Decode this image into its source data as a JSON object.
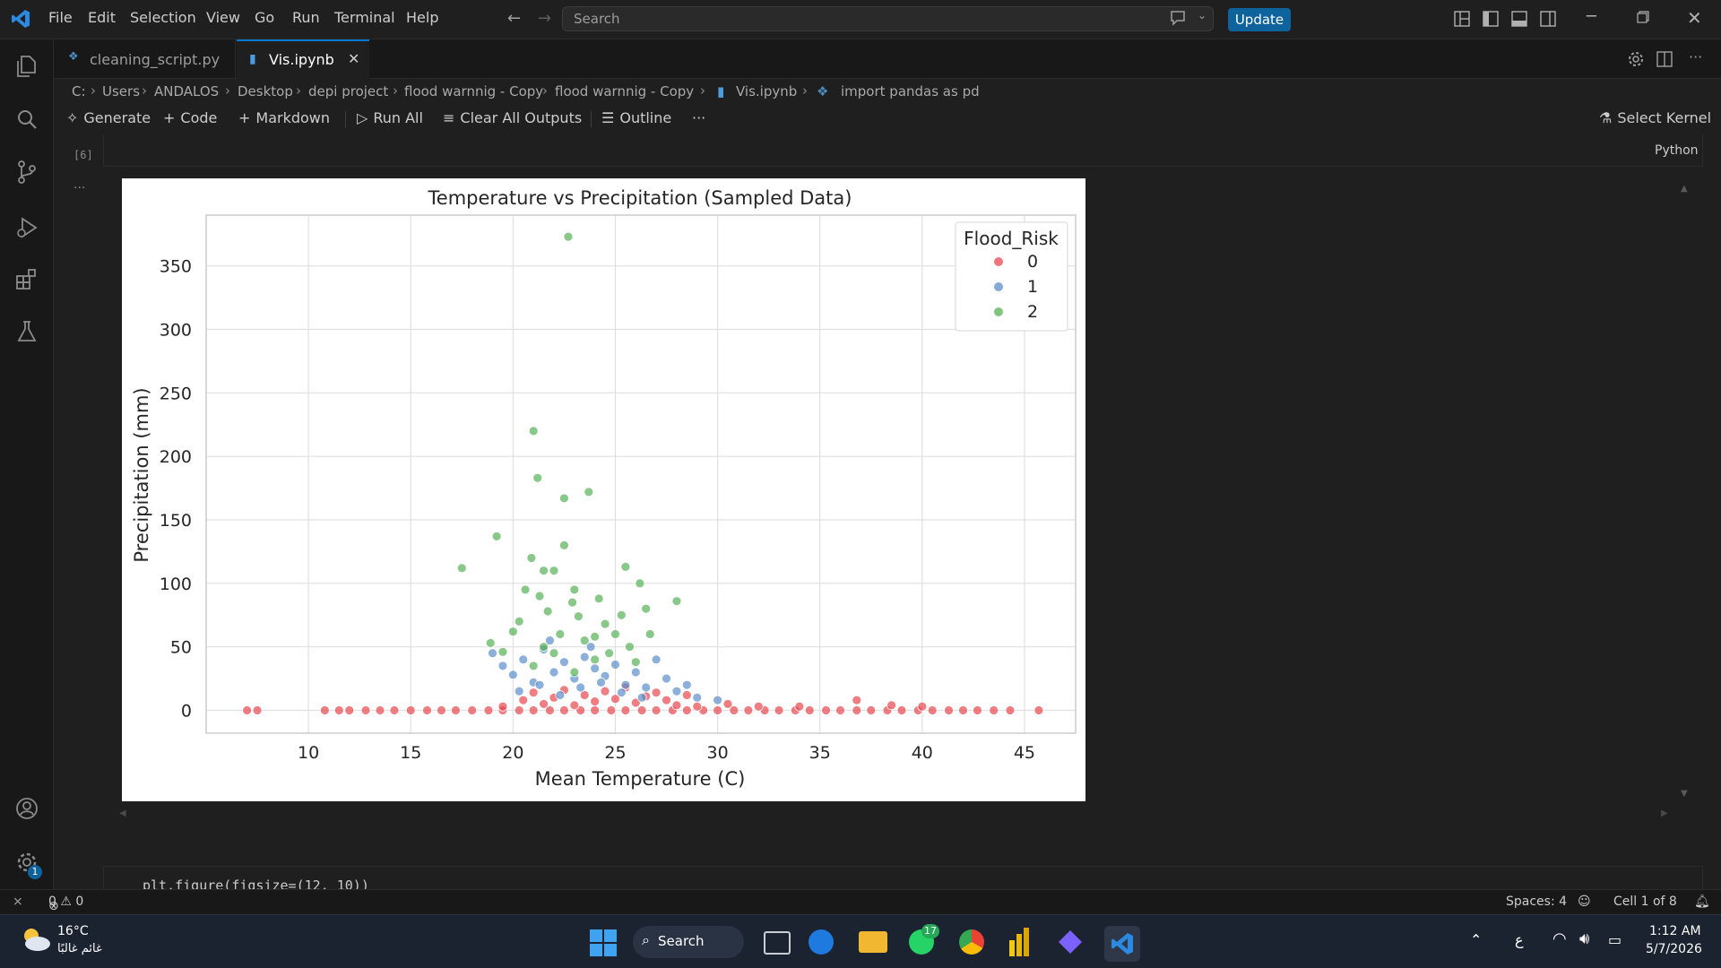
{
  "window": {
    "menu": [
      "File",
      "Edit",
      "Selection",
      "View",
      "Go",
      "Run",
      "Terminal",
      "Help"
    ],
    "search_placeholder": "Search",
    "update_label": "Update"
  },
  "tabs": [
    {
      "label": "cleaning_script.py",
      "active": false
    },
    {
      "label": "Vis.ipynb",
      "active": true
    }
  ],
  "breadcrumb": [
    "C:",
    "Users",
    "ANDALOS",
    "Desktop",
    "depi project",
    "flood warnnig - Copy",
    "flood warnnig - Copy",
    "Vis.ipynb",
    "import pandas as pd"
  ],
  "notebook_toolbar": {
    "generate": "Generate",
    "code": "Code",
    "markdown": "Markdown",
    "run_all": "Run All",
    "clear_outputs": "Clear All Outputs",
    "outline": "Outline",
    "more": "···",
    "select_kernel": "Select Kernel"
  },
  "cell": {
    "exec_count": "[6]",
    "language": "Python",
    "output_ellipsis": "...",
    "next_cell_code": "plt.figure(figsize=(12, 10))"
  },
  "chart_data": {
    "type": "scatter",
    "title": "Temperature vs Precipitation (Sampled Data)",
    "xlabel": "Mean Temperature (C)",
    "ylabel": "Precipitation (mm)",
    "xlim": [
      5,
      47.5
    ],
    "ylim": [
      -18,
      390
    ],
    "x_ticks": [
      10,
      15,
      20,
      25,
      30,
      35,
      40,
      45
    ],
    "y_ticks": [
      0,
      50,
      100,
      150,
      200,
      250,
      300,
      350
    ],
    "grid": true,
    "legend": {
      "title": "Flood_Risk",
      "position": "top-right"
    },
    "series": [
      {
        "name": "0",
        "color": "#e8474f",
        "points": [
          [
            7.0,
            0
          ],
          [
            7.5,
            0
          ],
          [
            10.8,
            0
          ],
          [
            11.5,
            0
          ],
          [
            12.0,
            0
          ],
          [
            12.8,
            0
          ],
          [
            13.5,
            0
          ],
          [
            14.2,
            0
          ],
          [
            15.0,
            0
          ],
          [
            15.8,
            0
          ],
          [
            16.5,
            0
          ],
          [
            17.2,
            0
          ],
          [
            18.0,
            0
          ],
          [
            18.8,
            0
          ],
          [
            19.5,
            0
          ],
          [
            20.3,
            0
          ],
          [
            21.0,
            0
          ],
          [
            21.8,
            0
          ],
          [
            22.5,
            0
          ],
          [
            23.3,
            0
          ],
          [
            24.0,
            0
          ],
          [
            24.8,
            0
          ],
          [
            25.5,
            0
          ],
          [
            26.3,
            0
          ],
          [
            27.0,
            0
          ],
          [
            27.8,
            0
          ],
          [
            28.5,
            0
          ],
          [
            29.3,
            0
          ],
          [
            30.0,
            0
          ],
          [
            30.8,
            0
          ],
          [
            31.5,
            0
          ],
          [
            32.3,
            0
          ],
          [
            33.0,
            0
          ],
          [
            33.8,
            0
          ],
          [
            34.5,
            0
          ],
          [
            35.3,
            0
          ],
          [
            36.0,
            0
          ],
          [
            36.8,
            0
          ],
          [
            37.5,
            0
          ],
          [
            38.3,
            0
          ],
          [
            39.0,
            0
          ],
          [
            39.8,
            0
          ],
          [
            40.5,
            0
          ],
          [
            41.3,
            0
          ],
          [
            42.0,
            0
          ],
          [
            42.7,
            0
          ],
          [
            43.5,
            0
          ],
          [
            44.3,
            0
          ],
          [
            45.7,
            0
          ],
          [
            19.5,
            3
          ],
          [
            20.5,
            8
          ],
          [
            21.0,
            14
          ],
          [
            21.5,
            5
          ],
          [
            22.0,
            10
          ],
          [
            22.5,
            16
          ],
          [
            23.0,
            4
          ],
          [
            23.5,
            12
          ],
          [
            24.0,
            7
          ],
          [
            24.5,
            15
          ],
          [
            25.0,
            9
          ],
          [
            25.5,
            18
          ],
          [
            26.0,
            6
          ],
          [
            26.5,
            11
          ],
          [
            27.0,
            14
          ],
          [
            27.5,
            8
          ],
          [
            28.0,
            4
          ],
          [
            28.5,
            12
          ],
          [
            29.0,
            3
          ],
          [
            30.5,
            5
          ],
          [
            32.0,
            3
          ],
          [
            34.0,
            3
          ],
          [
            36.8,
            8
          ],
          [
            38.5,
            4
          ],
          [
            40.0,
            3
          ]
        ]
      },
      {
        "name": "1",
        "color": "#5b8fc9",
        "points": [
          [
            19.0,
            45
          ],
          [
            19.5,
            35
          ],
          [
            20.0,
            28
          ],
          [
            20.5,
            40
          ],
          [
            21.0,
            22
          ],
          [
            21.5,
            48
          ],
          [
            22.0,
            30
          ],
          [
            22.5,
            38
          ],
          [
            23.0,
            25
          ],
          [
            23.5,
            42
          ],
          [
            24.0,
            33
          ],
          [
            24.5,
            27
          ],
          [
            25.0,
            36
          ],
          [
            25.5,
            20
          ],
          [
            26.0,
            30
          ],
          [
            26.5,
            18
          ],
          [
            27.0,
            40
          ],
          [
            27.5,
            25
          ],
          [
            28.0,
            15
          ],
          [
            28.5,
            20
          ],
          [
            29.0,
            10
          ],
          [
            30.0,
            8
          ],
          [
            20.3,
            15
          ],
          [
            21.3,
            20
          ],
          [
            22.3,
            12
          ],
          [
            23.3,
            18
          ],
          [
            24.3,
            22
          ],
          [
            25.3,
            14
          ],
          [
            26.3,
            10
          ],
          [
            21.8,
            55
          ],
          [
            23.8,
            50
          ]
        ]
      },
      {
        "name": "2",
        "color": "#55b055",
        "points": [
          [
            17.5,
            112
          ],
          [
            18.9,
            53
          ],
          [
            19.2,
            137
          ],
          [
            19.5,
            46
          ],
          [
            20.0,
            62
          ],
          [
            20.3,
            70
          ],
          [
            20.6,
            95
          ],
          [
            20.9,
            120
          ],
          [
            21.0,
            220
          ],
          [
            21.2,
            183
          ],
          [
            21.3,
            90
          ],
          [
            21.5,
            110
          ],
          [
            21.7,
            78
          ],
          [
            22.0,
            110
          ],
          [
            22.3,
            60
          ],
          [
            22.5,
            167
          ],
          [
            22.5,
            130
          ],
          [
            22.7,
            373
          ],
          [
            22.9,
            85
          ],
          [
            23.0,
            95
          ],
          [
            23.2,
            74
          ],
          [
            23.5,
            55
          ],
          [
            23.7,
            172
          ],
          [
            24.0,
            40
          ],
          [
            24.2,
            88
          ],
          [
            24.5,
            68
          ],
          [
            24.7,
            45
          ],
          [
            25.0,
            60
          ],
          [
            25.3,
            75
          ],
          [
            25.5,
            113
          ],
          [
            25.7,
            50
          ],
          [
            26.0,
            38
          ],
          [
            26.2,
            100
          ],
          [
            26.5,
            80
          ],
          [
            26.7,
            60
          ],
          [
            28.0,
            86
          ],
          [
            21.5,
            50
          ],
          [
            22.0,
            45
          ],
          [
            23.0,
            30
          ],
          [
            24.0,
            58
          ],
          [
            21.0,
            35
          ]
        ]
      }
    ]
  },
  "status": {
    "errors": "0",
    "warnings": "0",
    "spaces": "Spaces: 4",
    "cell_pos": "Cell 1 of 8"
  },
  "taskbar": {
    "weather_temp": "16°C",
    "weather_desc": "غائم غالبًا",
    "search_label": "Search",
    "lang": "ع",
    "time": "1:12 AM",
    "date": "5/7/2026",
    "whatsapp_badge": "17"
  }
}
